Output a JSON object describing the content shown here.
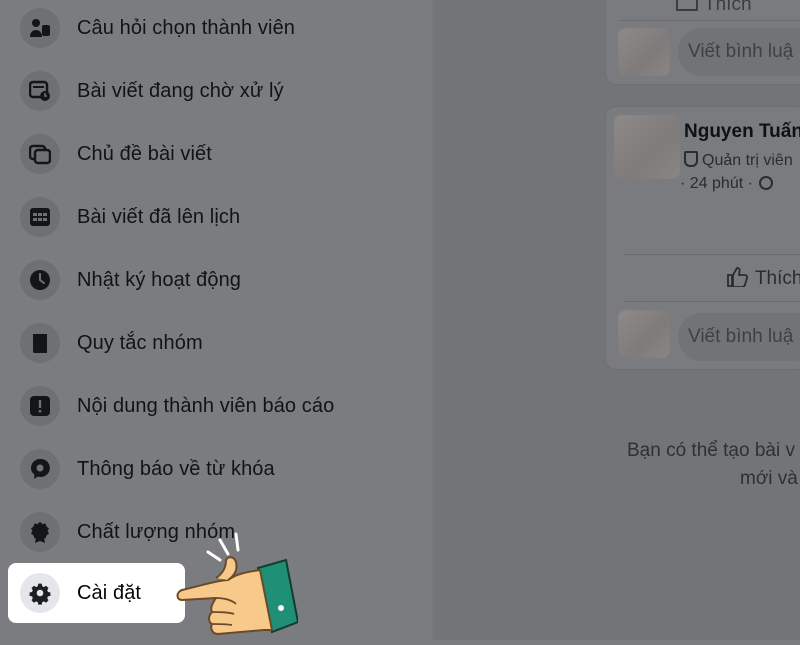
{
  "sidebar": {
    "items": [
      {
        "label": "Câu hỏi chọn thành viên",
        "icon": "member-question-icon"
      },
      {
        "label": "Bài viết đang chờ xử lý",
        "icon": "pending-posts-icon"
      },
      {
        "label": "Chủ đề bài viết",
        "icon": "post-topics-icon"
      },
      {
        "label": "Bài viết đã lên lịch",
        "icon": "calendar-icon"
      },
      {
        "label": "Nhật ký hoạt động",
        "icon": "clock-icon"
      },
      {
        "label": "Quy tắc nhóm",
        "icon": "book-icon"
      },
      {
        "label": "Nội dung thành viên báo cáo",
        "icon": "alert-icon"
      },
      {
        "label": "Thông báo về từ khóa",
        "icon": "keyword-alert-icon"
      },
      {
        "label": "Chất lượng nhóm",
        "icon": "badge-icon"
      },
      {
        "label": "Cài đặt",
        "icon": "gear-icon",
        "active": true
      }
    ]
  },
  "feed": {
    "top_like_label": "Thích",
    "comment_placeholder": "Viết bình luậ",
    "post": {
      "author": "Nguyen Tuấn",
      "role": "Quản trị viên",
      "meta": "· 24 phút ·",
      "like_label": "Thích"
    },
    "empty_message_line1": "Bạn có thể tạo bài v",
    "empty_message_line2": "mới và"
  },
  "colors": {
    "overlay_background": "#7b7c7f",
    "active_item_background": "#ffffff",
    "text_dark": "#121315",
    "hand_skin": "#f7c98a",
    "hand_cuff": "#1f8f75"
  }
}
